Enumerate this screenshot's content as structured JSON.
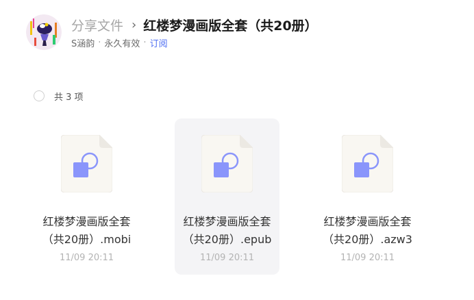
{
  "breadcrumb": {
    "root": "分享文件",
    "separator": "›",
    "current": "红楼梦漫画版全套（共20册）"
  },
  "share_meta": {
    "author": "S涵韵",
    "validity": "永久有效",
    "subscribe": "订阅",
    "separator": "·"
  },
  "list": {
    "count_text": "共 3 项"
  },
  "files": [
    {
      "line1": "红楼梦漫画版全套",
      "line2": "（共20册）.mobi",
      "time": "11/09 20:11",
      "icon": "ebook-file-icon"
    },
    {
      "line1": "红楼梦漫画版全套",
      "line2": "（共20册）.epub",
      "time": "11/09 20:11",
      "icon": "ebook-file-icon"
    },
    {
      "line1": "红楼梦漫画版全套",
      "line2": "（共20册）.azw3",
      "time": "11/09 20:11",
      "icon": "ebook-file-icon"
    }
  ],
  "colors": {
    "accent": "#4e6ef2",
    "icon_square": "#8a95fb",
    "hover_bg": "#f4f4f6"
  }
}
